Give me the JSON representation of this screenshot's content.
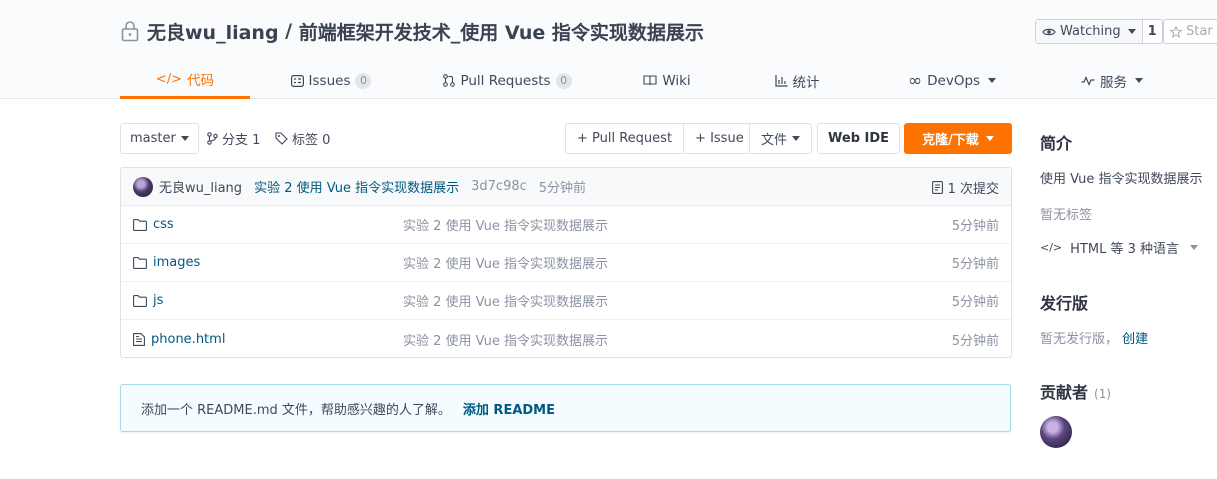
{
  "repo": {
    "owner": "无良wu_liang",
    "separator": " / ",
    "name": "前端框架开发技术_使用 Vue 指令实现数据展示",
    "watch_label": "Watching",
    "watch_count": "1",
    "star_label": "Star"
  },
  "tabs": [
    {
      "label": "代码",
      "icon": "code-icon"
    },
    {
      "label": "Issues",
      "count": "0",
      "icon": "issues-icon"
    },
    {
      "label": "Pull Requests",
      "count": "0",
      "icon": "pull-request-icon"
    },
    {
      "label": "Wiki",
      "icon": "wiki-icon"
    },
    {
      "label": "统计",
      "icon": "stats-icon"
    },
    {
      "label": "DevOps",
      "icon": "devops-icon"
    },
    {
      "label": "服务",
      "icon": "service-icon"
    }
  ],
  "toolbar": {
    "branch": "master",
    "branches": "分支 1",
    "tags": "标签 0",
    "pull_request": "+ Pull Request",
    "issue": "+ Issue",
    "file": "文件",
    "web_ide": "Web IDE",
    "clone": "克隆/下载"
  },
  "commit": {
    "author": "无良wu_liang",
    "message": "实验 2 使用 Vue 指令实现数据展示",
    "sha": "3d7c98c",
    "time": "5分钟前",
    "count": "1 次提交"
  },
  "files": [
    {
      "name": "css",
      "type": "folder",
      "commit": "实验 2 使用 Vue 指令实现数据展示",
      "time": "5分钟前"
    },
    {
      "name": "images",
      "type": "folder",
      "commit": "实验 2 使用 Vue 指令实现数据展示",
      "time": "5分钟前"
    },
    {
      "name": "js",
      "type": "folder",
      "commit": "实验 2 使用 Vue 指令实现数据展示",
      "time": "5分钟前"
    },
    {
      "name": "phone.html",
      "type": "file",
      "commit": "实验 2 使用 Vue 指令实现数据展示",
      "time": "5分钟前"
    }
  ],
  "readme": {
    "notice": "添加一个 README.md 文件，帮助感兴趣的人了解。",
    "add_link": "添加 README"
  },
  "sidebar": {
    "intro_title": "简介",
    "description": "使用 Vue 指令实现数据展示",
    "no_tags": "暂无标签",
    "languages": "HTML 等 3 种语言",
    "release_title": "发行版",
    "no_release": "暂无发行版，",
    "create_link": "创建",
    "contributors_title": "贡献者",
    "contributors_count": "(1)"
  },
  "colors": {
    "accent": "#fe7300",
    "link": "#005980",
    "muted": "#8c92a4"
  }
}
